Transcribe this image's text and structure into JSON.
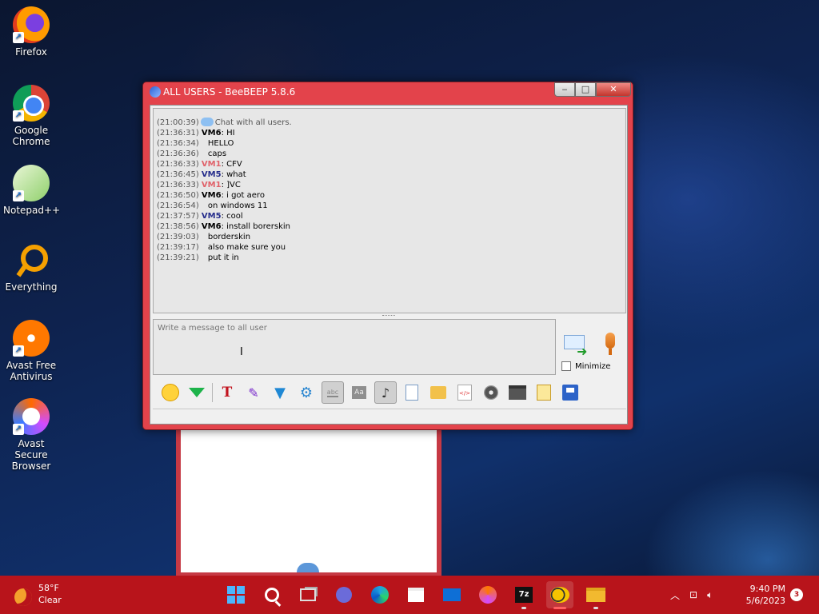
{
  "desktop": {
    "icons": [
      {
        "label": "Firefox",
        "icon": "firefox-icon"
      },
      {
        "label": "Google\nChrome",
        "icon": "chrome-icon"
      },
      {
        "label": "Notepad++",
        "icon": "notepadpp-icon"
      },
      {
        "label": "Everything",
        "icon": "everything-icon"
      },
      {
        "label": "Avast Free\nAntivirus",
        "icon": "avast-icon"
      },
      {
        "label": "Avast Secure\nBrowser",
        "icon": "avast-browser-icon"
      }
    ]
  },
  "window": {
    "title": "ALL USERS - BeeBEEP 5.8.6",
    "controls": {
      "minimize": "‒",
      "maximize": "□",
      "close": "✕"
    }
  },
  "chat": {
    "system_line": {
      "time": "(21:00:39)",
      "text": "Chat with all users."
    },
    "lines": [
      {
        "time": "(21:36:31)",
        "user": "VM6",
        "sep": ": ",
        "text": "HI",
        "color": "#000000"
      },
      {
        "time": "(21:36:34)",
        "user": "",
        "sep": "",
        "text": "HELLO",
        "color": "#000000"
      },
      {
        "time": "(21:36:36)",
        "user": "",
        "sep": "",
        "text": "caps",
        "color": "#000000"
      },
      {
        "time": "(21:36:33)",
        "user": "VM1",
        "sep": ": ",
        "text": "CFV",
        "color": "#e0626a"
      },
      {
        "time": "(21:36:45)",
        "user": "VM5",
        "sep": ": ",
        "text": "what",
        "color": "#262e8c"
      },
      {
        "time": "(21:36:33)",
        "user": "VM1",
        "sep": ": ",
        "text": "]VC",
        "color": "#e0626a"
      },
      {
        "time": "(21:36:50)",
        "user": "VM6",
        "sep": ": ",
        "text": "i got aero",
        "color": "#000000"
      },
      {
        "time": "(21:36:54)",
        "user": "",
        "sep": "",
        "text": "on windows 11",
        "color": "#000000"
      },
      {
        "time": "(21:37:57)",
        "user": "VM5",
        "sep": ": ",
        "text": "cool",
        "color": "#262e8c"
      },
      {
        "time": "(21:38:56)",
        "user": "VM6",
        "sep": ": ",
        "text": "install borerskin",
        "color": "#000000"
      },
      {
        "time": "(21:39:03)",
        "user": "",
        "sep": "",
        "text": "borderskin",
        "color": "#000000"
      },
      {
        "time": "(21:39:17)",
        "user": "",
        "sep": "",
        "text": "also make sure you",
        "color": "#000000"
      },
      {
        "time": "(21:39:21)",
        "user": "",
        "sep": "",
        "text": "put it in",
        "color": "#000000"
      }
    ]
  },
  "compose": {
    "placeholder": "Write a message to all user",
    "minimize_label": "Minimize"
  },
  "toolbar": {
    "items": [
      "emoticon-icon",
      "gem-icon",
      "font-icon",
      "color-pens-icon",
      "filter-icon",
      "settings-gear-icon",
      "spellcheck-icon",
      "font-size-icon",
      "sound-note-icon",
      "send-file-icon",
      "send-folder-icon",
      "code-icon",
      "screenshot-icon",
      "terminal-icon",
      "notes-icon",
      "save-icon"
    ]
  },
  "taskbar": {
    "weather": {
      "temp": "58°F",
      "condition": "Clear"
    },
    "clock": {
      "time": "9:40 PM",
      "date": "5/6/2023"
    },
    "notification_count": "3"
  },
  "colors": {
    "window_border": "#e3434b",
    "taskbar": "#b8141b"
  }
}
